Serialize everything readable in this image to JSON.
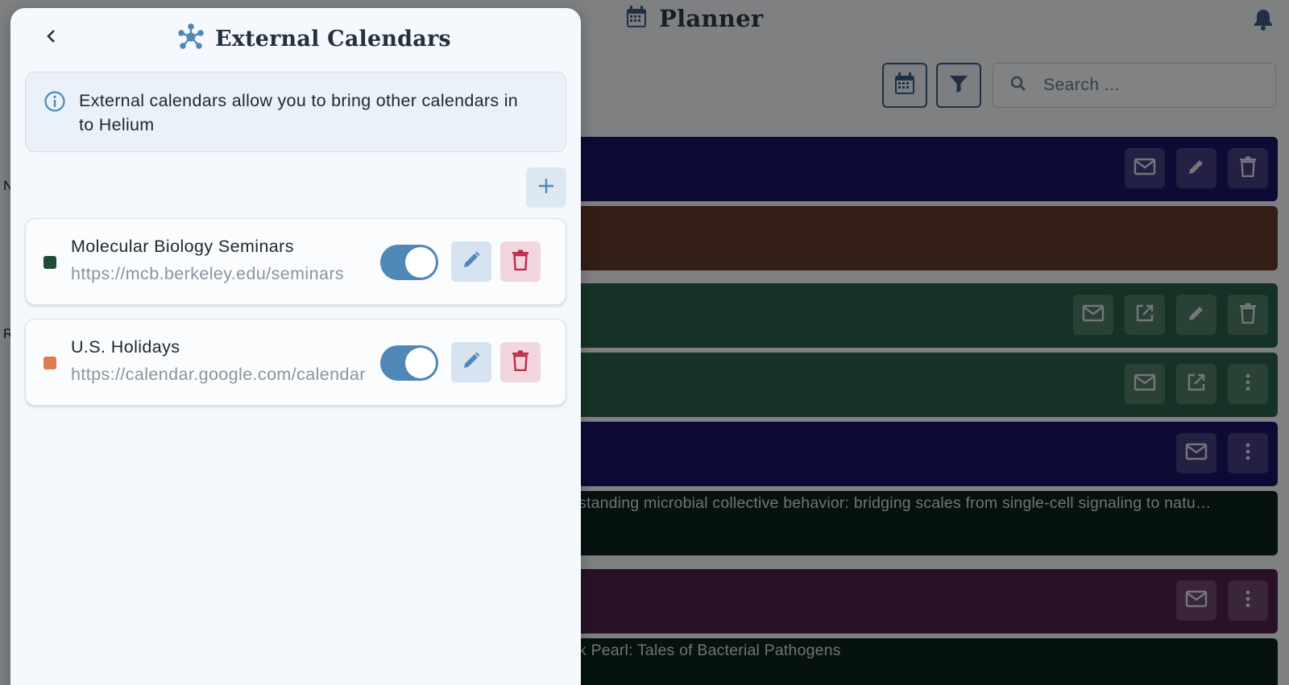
{
  "app": {
    "title": "Planner",
    "search_placeholder": "Search ...",
    "left_letters": [
      "N",
      "R"
    ],
    "rows": [
      {
        "color": "#1a1567",
        "text": "",
        "actions": [
          "mail-icon",
          "pencil-icon",
          "trash-icon"
        ]
      },
      {
        "color": "#623b29",
        "text": "",
        "actions": []
      },
      {
        "color": "#2b6149",
        "text": "",
        "actions": [
          "mail-icon",
          "open-in-new-icon",
          "pencil-icon",
          "trash-icon"
        ]
      },
      {
        "color": "#2b6149",
        "text": "",
        "actions": [
          "mail-icon",
          "open-in-new-icon",
          "more-vert-icon"
        ]
      },
      {
        "color": "#1a1567",
        "text": "",
        "actions": [
          "mail-icon",
          "more-vert-icon"
        ]
      },
      {
        "color": "#0b231b",
        "text": "standing microbial collective behavior: bridging scales from single-cell signaling to natu…",
        "actions": []
      },
      {
        "color": "#4f214b",
        "text": "",
        "actions": [
          "mail-icon",
          "more-vert-icon"
        ]
      },
      {
        "color": "#0b231b",
        "text": "k Pearl: Tales of Bacterial Pathogens",
        "actions": []
      }
    ]
  },
  "panel": {
    "title": "External Calendars",
    "info_text": "External calendars allow you to bring other calendars in to Helium",
    "calendars": [
      {
        "name": "Molecular Biology Seminars",
        "url": "https://mcb.berkeley.edu/seminars",
        "color": "#1d4d36",
        "enabled": true
      },
      {
        "name": "U.S. Holidays",
        "url": "https://calendar.google.com/calendar",
        "color": "#e07d4f",
        "enabled": true
      }
    ]
  },
  "colors": {
    "accent": "#4f87b8",
    "danger": "#c0284a"
  }
}
